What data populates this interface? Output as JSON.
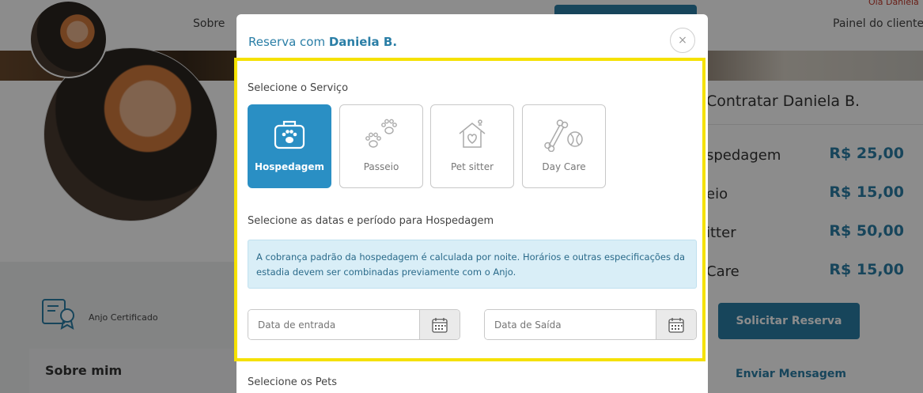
{
  "page": {
    "greeting_prefix": "Olá",
    "greeting_name": "Daniela",
    "nav_sobre": "Sobre",
    "nav_painel": "Painel do cliente",
    "anjo_label": "Anjo Certificado",
    "sobre_mim": "Sobre mim",
    "contratar": "Contratar Daniela B.",
    "prices": [
      {
        "name": "spedagem",
        "value": "R$ 25,00"
      },
      {
        "name": "eio",
        "value": "R$ 15,00"
      },
      {
        "name": "itter",
        "value": "R$ 50,00"
      },
      {
        "name": "Care",
        "value": "R$ 15,00"
      }
    ],
    "solicitar": "Solicitar Reserva",
    "enviar": "Enviar Mensagem"
  },
  "modal": {
    "title_prefix": "Reserva com",
    "title_name": "Daniela B.",
    "close_symbol": "×",
    "service_label": "Selecione o Serviço",
    "services": [
      {
        "label": "Hospedagem",
        "icon": "suitcase-paw-icon",
        "active": true
      },
      {
        "label": "Passeio",
        "icon": "paw-prints-icon",
        "active": false
      },
      {
        "label": "Pet sitter",
        "icon": "house-heart-icon",
        "active": false
      },
      {
        "label": "Day Care",
        "icon": "bone-ball-icon",
        "active": false
      }
    ],
    "dates_label": "Selecione as datas e período para Hospedagem",
    "info_text": "A cobrança padrão da hospedagem é calculada por noite. Horários e outras especificações da estadia devem ser combinadas previamente com o Anjo.",
    "date_in_placeholder": "Data de entrada",
    "date_out_placeholder": "Data de Saída",
    "pets_label": "Selecione os Pets"
  },
  "colors": {
    "accent": "#2a7ea6",
    "active_service": "#2a8fc4",
    "highlight": "#f5e100",
    "info_bg": "#d9eef7"
  }
}
